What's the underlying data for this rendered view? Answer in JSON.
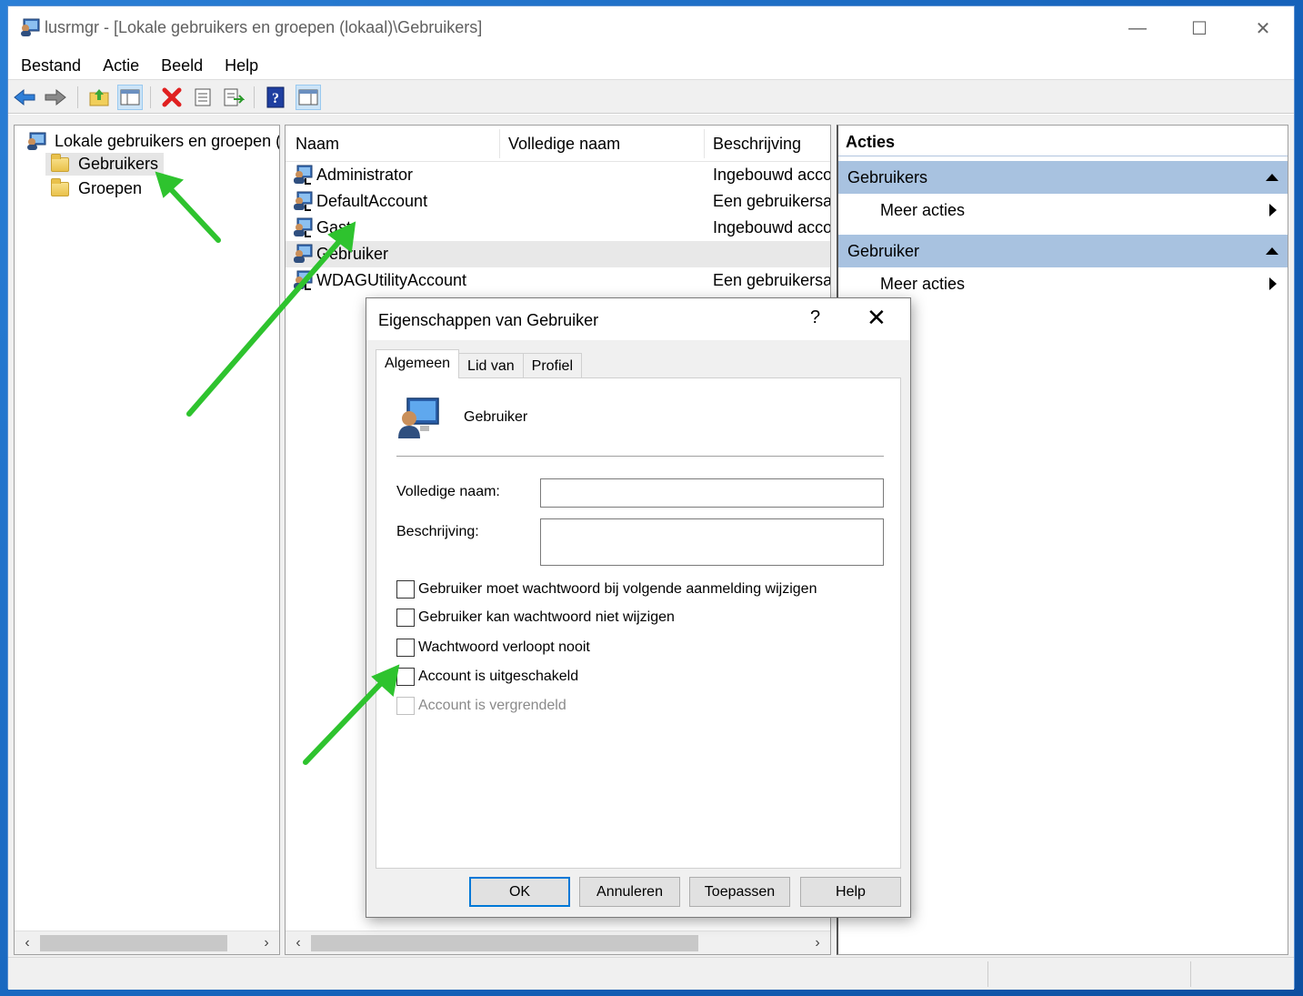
{
  "window": {
    "title": "lusrmgr - [Lokale gebruikers en groepen (lokaal)\\Gebruikers]",
    "icon": "computer-users-icon"
  },
  "window_controls": {
    "minimize": "—",
    "maximize": "☐",
    "close": "✕"
  },
  "menu": [
    "Bestand",
    "Actie",
    "Beeld",
    "Help"
  ],
  "toolbar": {
    "icons": [
      "back-arrow-icon",
      "forward-arrow-icon",
      "up-folder-icon",
      "show-hide-tree-icon",
      "delete-icon",
      "properties-icon",
      "export-list-icon",
      "help-icon",
      "show-hide-action-pane-icon"
    ]
  },
  "tree": {
    "root": "Lokale gebruikers en groepen (lc",
    "items": [
      "Gebruikers",
      "Groepen"
    ],
    "selected": "Gebruikers"
  },
  "list": {
    "columns": [
      "Naam",
      "Volledige naam",
      "Beschrijving"
    ],
    "rows": [
      {
        "name": "Administrator",
        "full_name": "",
        "description": "Ingebouwd acco"
      },
      {
        "name": "DefaultAccount",
        "full_name": "",
        "description": "Een gebruikersa"
      },
      {
        "name": "Gast",
        "full_name": "",
        "description": "Ingebouwd acco"
      },
      {
        "name": "Gebruiker",
        "full_name": "",
        "description": ""
      },
      {
        "name": "WDAGUtilityAccount",
        "full_name": "",
        "description": "Een gebruikersa"
      }
    ],
    "selected_row": "Gebruiker"
  },
  "actions": {
    "title": "Acties",
    "sections": [
      {
        "header": "Gebruikers",
        "item": "Meer acties"
      },
      {
        "header": "Gebruiker",
        "item": "Meer acties"
      }
    ]
  },
  "dialog": {
    "title": "Eigenschappen van Gebruiker",
    "help_glyph": "?",
    "close_glyph": "✕",
    "tabs": [
      "Algemeen",
      "Lid van",
      "Profiel"
    ],
    "active_tab": "Algemeen",
    "user_name": "Gebruiker",
    "fields": {
      "full_name_label": "Volledige naam:",
      "full_name_value": "",
      "description_label": "Beschrijving:",
      "description_value": ""
    },
    "checkboxes": [
      {
        "label": "Gebruiker moet wachtwoord bij volgende aanmelding wijzigen",
        "checked": false,
        "enabled": true
      },
      {
        "label": "Gebruiker kan wachtwoord niet wijzigen",
        "checked": false,
        "enabled": true
      },
      {
        "label": "Wachtwoord verloopt nooit",
        "checked": false,
        "enabled": true
      },
      {
        "label": "Account is uitgeschakeld",
        "checked": false,
        "enabled": true
      },
      {
        "label": "Account is vergrendeld",
        "checked": false,
        "enabled": false
      }
    ],
    "buttons": [
      "OK",
      "Annuleren",
      "Toepassen",
      "Help"
    ]
  },
  "colors": {
    "annotation_arrow": "#2ec32e",
    "action_header": "#a8c2e0",
    "default_button_border": "#0078d7"
  }
}
